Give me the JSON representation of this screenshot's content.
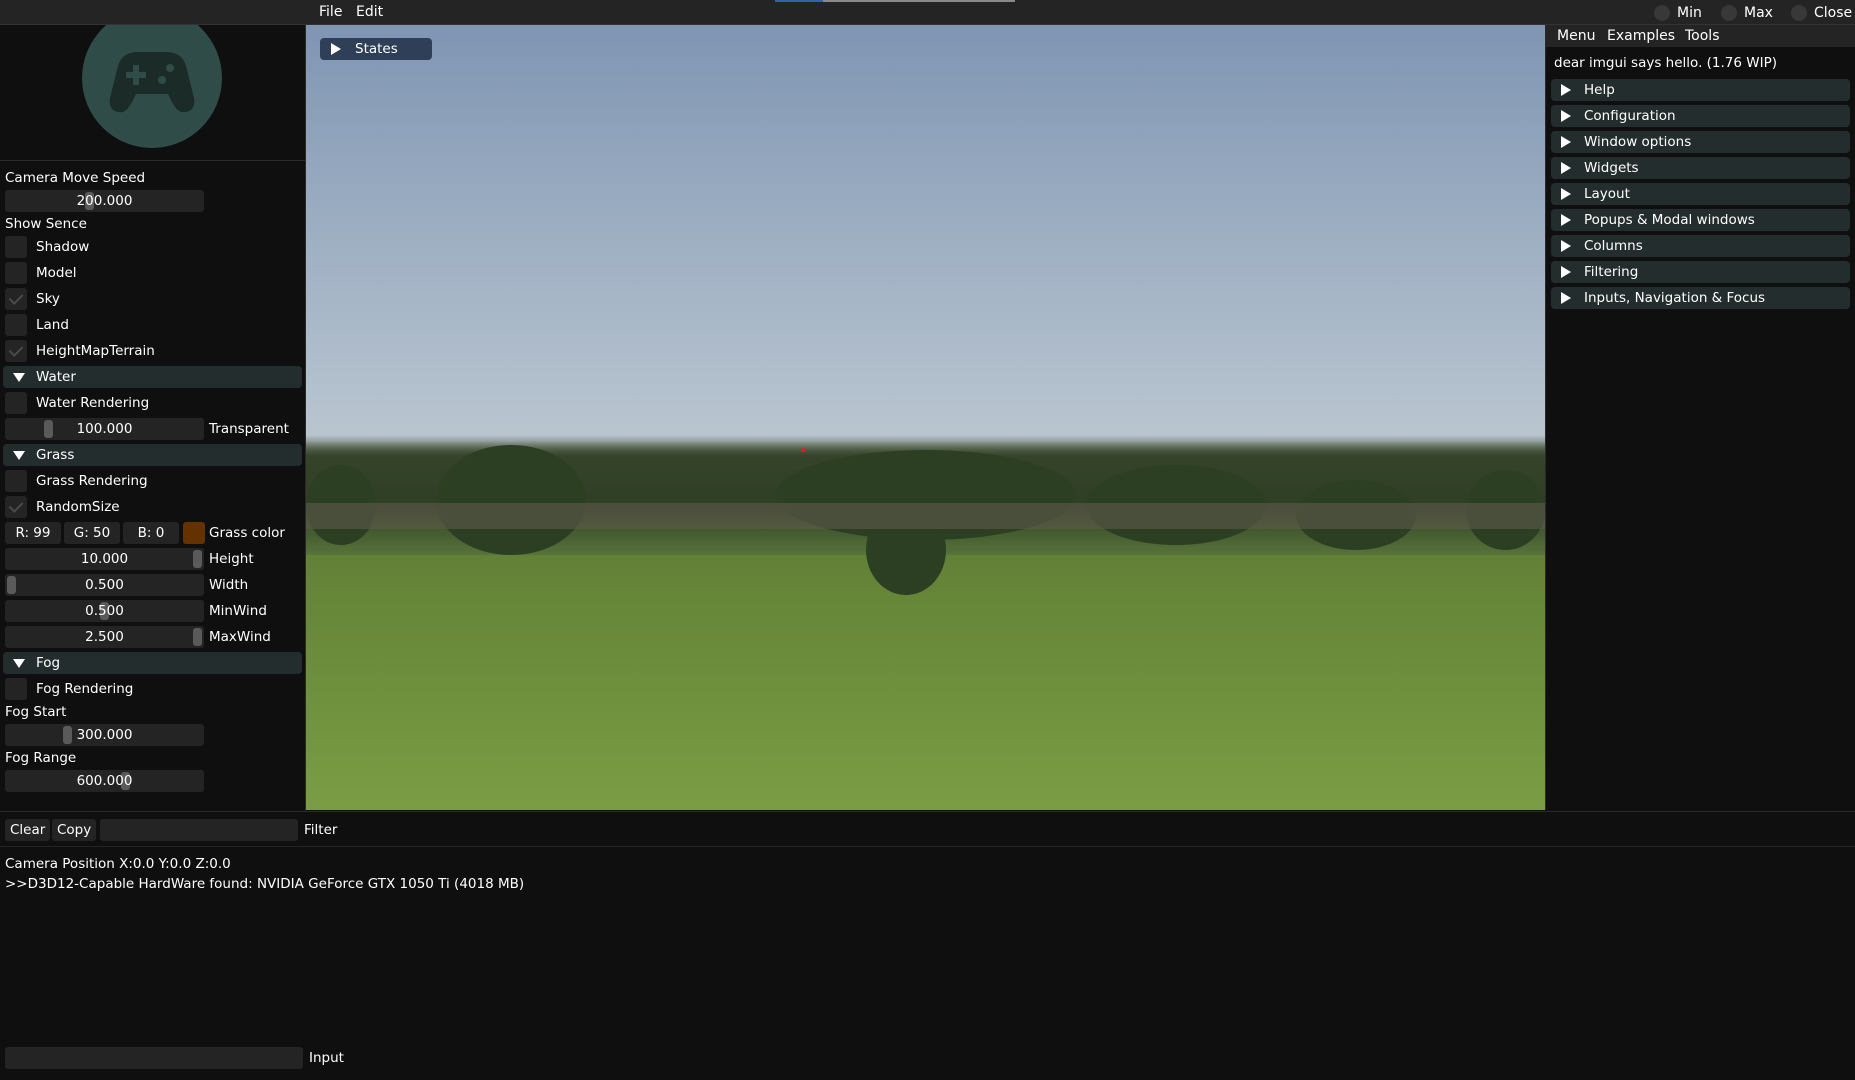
{
  "menubar": {
    "file": "File",
    "edit": "Edit",
    "min": "Min",
    "max": "Max",
    "close": "Close"
  },
  "left_panel": {
    "logo_icon": "gamepad-icon",
    "camera_move_speed": {
      "label": "Camera Move Speed",
      "value": "200.000"
    },
    "show_scene_label": "Show Sence",
    "checkboxes": [
      {
        "label": "Shadow",
        "checked": false
      },
      {
        "label": "Model",
        "checked": false
      },
      {
        "label": "Sky",
        "checked": true
      },
      {
        "label": "Land",
        "checked": false
      },
      {
        "label": "HeightMapTerrain",
        "checked": true
      }
    ],
    "water": {
      "header": "Water",
      "rendering": {
        "label": "Water Rendering",
        "checked": false
      },
      "transparent": {
        "label": "Transparent",
        "value": "100.000"
      }
    },
    "grass": {
      "header": "Grass",
      "rendering": {
        "label": "Grass Rendering",
        "checked": false
      },
      "random_size": {
        "label": "RandomSize",
        "checked": true
      },
      "color": {
        "r": "R: 99",
        "g": "G: 50",
        "b": "B:  0",
        "label": "Grass color",
        "hex": "#633200"
      },
      "height": {
        "label": "Height",
        "value": "10.000"
      },
      "width": {
        "label": "Width",
        "value": "0.500"
      },
      "min_wind": {
        "label": "MinWind",
        "value": "0.500"
      },
      "max_wind": {
        "label": "MaxWind",
        "value": "2.500"
      }
    },
    "fog": {
      "header": "Fog",
      "rendering": {
        "label": "Fog Rendering",
        "checked": false
      },
      "start": {
        "label": "Fog Start",
        "value": "300.000"
      },
      "range": {
        "label": "Fog Range",
        "value": "600.000"
      }
    }
  },
  "viewport": {
    "states_label": "States"
  },
  "right_panel": {
    "menu": [
      "Menu",
      "Examples",
      "Tools"
    ],
    "hello": "dear imgui says hello. (1.76 WIP)",
    "sections": [
      "Help",
      "Configuration",
      "Window options",
      "Widgets",
      "Layout",
      "Popups & Modal windows",
      "Columns",
      "Filtering",
      "Inputs, Navigation & Focus"
    ]
  },
  "console": {
    "clear": "Clear",
    "copy": "Copy",
    "filter_label": "Filter",
    "lines": [
      "Camera Position X:0.0 Y:0.0 Z:0.0",
      ">>D3D12-Capable HardWare found:  NVIDIA GeForce GTX 1050 Ti (4018 MB)"
    ],
    "input_label": "Input"
  },
  "colors": {
    "header_bg": "#242d2d",
    "frame_bg": "#242424",
    "window_bg": "#0f0f0f",
    "states_bg": "#2f3f57",
    "grass_swatch": "#633200"
  }
}
